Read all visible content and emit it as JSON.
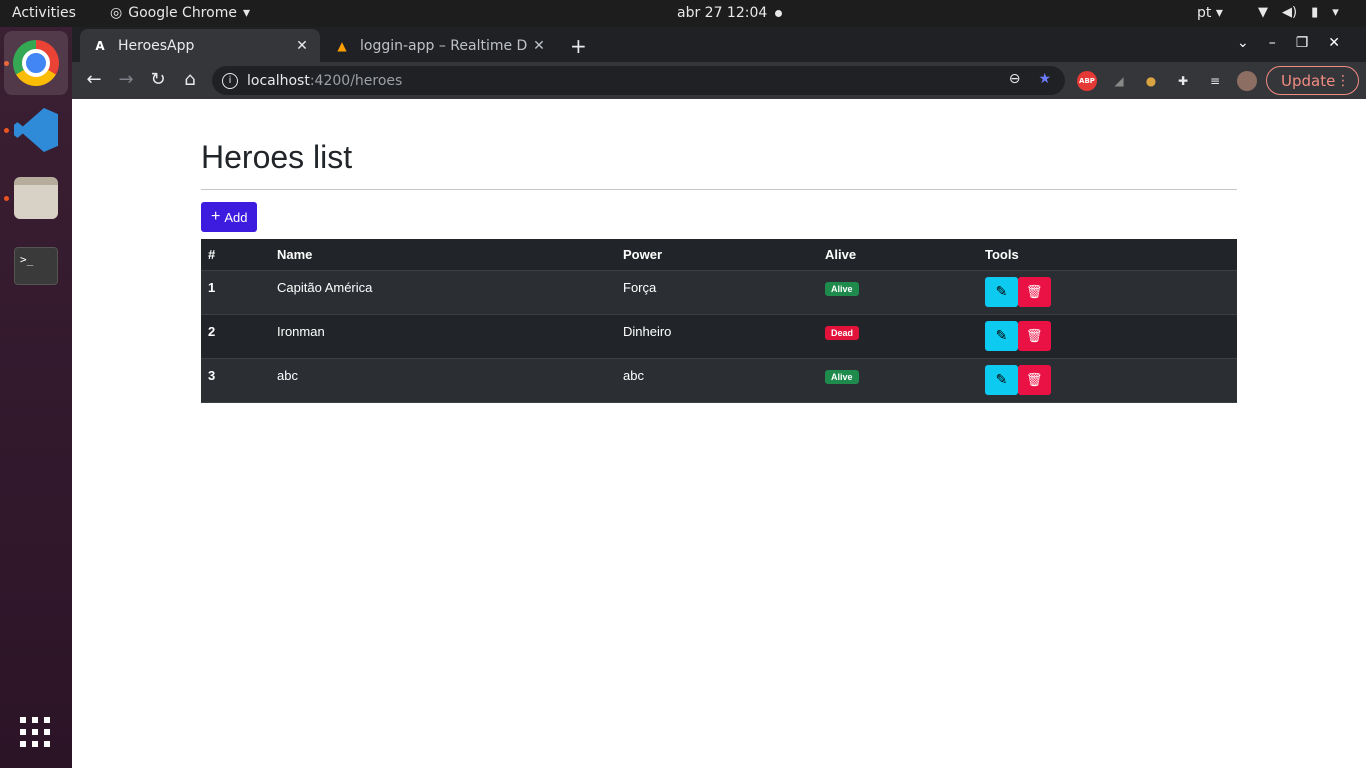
{
  "system": {
    "activities": "Activities",
    "app_menu": "Google Chrome",
    "clock": "abr 27  12:04",
    "language": "pt"
  },
  "browser": {
    "tabs": [
      {
        "title": "HeroesApp",
        "favicon": "A",
        "active": true
      },
      {
        "title": "loggin-app – Realtime Dat",
        "favicon": "firebase-icon",
        "active": false
      }
    ],
    "url_host": "localhost",
    "url_path": ":4200/heroes",
    "update_label": "Update",
    "extensions": {
      "abp_label": "ABP"
    }
  },
  "page": {
    "title": "Heroes list",
    "add_button_label": "Add",
    "table": {
      "headers": [
        "#",
        "Name",
        "Power",
        "Alive",
        "Tools"
      ],
      "rows": [
        {
          "id": "1",
          "name": "Capitão América",
          "power": "Força",
          "status": "Alive"
        },
        {
          "id": "2",
          "name": "Ironman",
          "power": "Dinheiro",
          "status": "Dead"
        },
        {
          "id": "3",
          "name": "abc",
          "power": "abc",
          "status": "Alive"
        }
      ]
    }
  },
  "colors": {
    "primary": "#3d1bdf",
    "alive": "#1e8a4c",
    "dead": "#e1133b",
    "edit": "#0dcaf0",
    "delete": "#ea1145"
  }
}
